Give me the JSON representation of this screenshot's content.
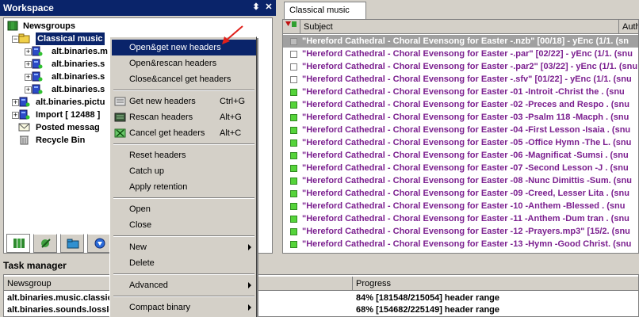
{
  "workspace": {
    "title": "Workspace",
    "pin_glyph": "⬍",
    "close_glyph": "✕",
    "tree": [
      {
        "label": "Newsgroups",
        "icon": "newsgroups-icon",
        "expander": ""
      },
      {
        "label": "Classical music",
        "icon": "folder-icon",
        "expander": "−"
      },
      {
        "label": "alt.binaries.m",
        "icon": "newsgroup-icon",
        "expander": "+"
      },
      {
        "label": "alt.binaries.s",
        "icon": "newsgroup-icon",
        "expander": "+"
      },
      {
        "label": "alt.binaries.s",
        "icon": "newsgroup-icon",
        "expander": "+"
      },
      {
        "label": "alt.binaries.s",
        "icon": "newsgroup-icon",
        "expander": "+"
      },
      {
        "label": "alt.binaries.pictu",
        "icon": "newsgroup-icon",
        "expander": "+"
      },
      {
        "label": "Import  [ 12488 ]",
        "icon": "import-icon",
        "expander": "+"
      },
      {
        "label": "Posted messag",
        "icon": "envelope-icon",
        "expander": ""
      },
      {
        "label": "Recycle Bin",
        "icon": "recycle-bin-icon",
        "expander": ""
      }
    ],
    "tabs": [
      {
        "icon": "newsgroups-tab-icon"
      },
      {
        "icon": "search-tab-icon"
      },
      {
        "icon": "folder-tab-icon"
      },
      {
        "icon": "download-tab-icon"
      }
    ]
  },
  "articles": {
    "tab_label": "Classical music",
    "col_subject": "Subject",
    "col_author": "Auth",
    "rows": [
      {
        "subject": "\"Hereford Cathedral - Choral Evensong for Easter -.nzb\" [00/18] - yEnc (1/1. (sn",
        "status": "grey"
      },
      {
        "subject": "\"Hereford Cathedral - Choral Evensong for Easter -.par\" [02/22] - yEnc (1/1. (snu",
        "status": "empty"
      },
      {
        "subject": "\"Hereford Cathedral - Choral Evensong for Easter -.par2\" [03/22] - yEnc (1/1. (snu",
        "status": "empty"
      },
      {
        "subject": "\"Hereford Cathedral - Choral Evensong for Easter -.sfv\" [01/22] - yEnc (1/1. (snu",
        "status": "empty"
      },
      {
        "subject": "\"Hereford Cathedral - Choral Evensong for Easter -01 -Introit -Christ the   . (snu",
        "status": "green"
      },
      {
        "subject": "\"Hereford Cathedral - Choral Evensong for Easter -02 -Preces and Respo . (snu",
        "status": "green"
      },
      {
        "subject": "\"Hereford Cathedral - Choral Evensong for Easter -03 -Psalm 118 -Macph . (snu",
        "status": "green"
      },
      {
        "subject": "\"Hereford Cathedral - Choral Evensong for Easter -04 -First Lesson -Isaia . (snu",
        "status": "green"
      },
      {
        "subject": "\"Hereford Cathedral - Choral Evensong for Easter -05 -Office Hymn -The L. (snu",
        "status": "green"
      },
      {
        "subject": "\"Hereford Cathedral - Choral Evensong for Easter -06 -Magnificat -Sumsi  . (snu",
        "status": "green"
      },
      {
        "subject": "\"Hereford Cathedral - Choral Evensong for Easter -07 -Second Lesson -J  . (snu",
        "status": "green"
      },
      {
        "subject": "\"Hereford Cathedral - Choral Evensong for Easter -08 -Nunc Dimittis -Sum. (snu",
        "status": "green"
      },
      {
        "subject": "\"Hereford Cathedral - Choral Evensong for Easter -09 -Creed, Lesser Lita . (snu",
        "status": "green"
      },
      {
        "subject": "\"Hereford Cathedral - Choral Evensong for Easter -10 -Anthem -Blessed  . (snu",
        "status": "green"
      },
      {
        "subject": "\"Hereford Cathedral - Choral Evensong for Easter -11 -Anthem -Dum tran . (snu",
        "status": "green"
      },
      {
        "subject": "\"Hereford Cathedral - Choral Evensong for Easter -12 -Prayers.mp3\" [15/2. (snu",
        "status": "green"
      },
      {
        "subject": "\"Hereford Cathedral - Choral Evensong for Easter -13 -Hymn -Good Christ. (snu",
        "status": "green"
      }
    ]
  },
  "task_manager": {
    "title": "Task manager",
    "col_newsgroup": "Newsgroup",
    "col_progress": "Progress",
    "rows": [
      {
        "newsgroup": "alt.binaries.music.classical",
        "progress": "84% [181548/215054] header range"
      },
      {
        "newsgroup": "alt.binaries.sounds.lossless",
        "progress": "68% [154682/225149] header range"
      }
    ]
  },
  "context_menu": {
    "items": [
      {
        "label": "Open&get new headers",
        "highlighted": true
      },
      {
        "label": "Open&rescan headers"
      },
      {
        "label": "Close&cancel get headers"
      },
      {
        "sep": true
      },
      {
        "label": "Get new headers",
        "shortcut": "Ctrl+G",
        "icon": "get-headers-icon"
      },
      {
        "label": "Rescan headers",
        "shortcut": "Alt+G",
        "icon": "rescan-headers-icon"
      },
      {
        "label": "Cancel get headers",
        "shortcut": "Alt+C",
        "icon": "cancel-headers-icon"
      },
      {
        "sep": true
      },
      {
        "label": "Reset headers"
      },
      {
        "label": "Catch up"
      },
      {
        "label": "Apply retention"
      },
      {
        "sep": true
      },
      {
        "label": "Open"
      },
      {
        "label": "Close"
      },
      {
        "sep": true
      },
      {
        "label": "New",
        "submenu": true
      },
      {
        "label": "Delete"
      },
      {
        "sep": true
      },
      {
        "label": "Advanced",
        "submenu": true
      },
      {
        "sep": true
      },
      {
        "label": "Compact binary",
        "submenu": true
      }
    ]
  },
  "colors": {
    "titlebar": "#0a246a",
    "article_text": "#7b1f8f",
    "downloaded": "#55d43a",
    "pointer_arrow": "#e0201a"
  }
}
